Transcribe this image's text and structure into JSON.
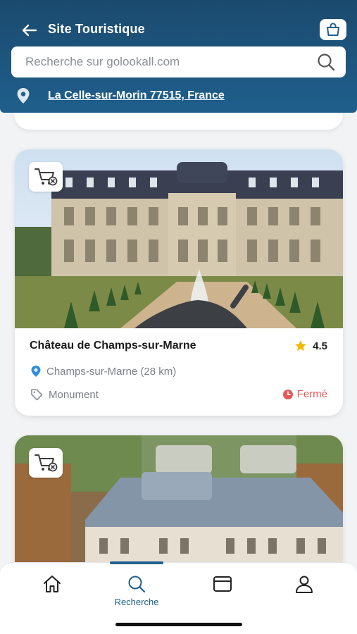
{
  "header": {
    "title": "Site Touristique",
    "back_icon": "arrow-left-icon",
    "cart_icon": "shopping-bag-icon"
  },
  "search": {
    "placeholder": "Recherche sur golookall.com",
    "icon": "search-icon"
  },
  "location": {
    "text": "La Celle-sur-Morin 77515, France",
    "icon": "location-pin-icon"
  },
  "cards": [
    {
      "name": "Château de Champs-sur-Marne",
      "rating": "4.5",
      "place": "Champs-sur-Marne (28 km)",
      "category": "Monument",
      "status": "Fermé",
      "badge_icon": "cart-remove-icon"
    },
    {
      "badge_icon": "cart-remove-icon"
    }
  ],
  "nav": {
    "items": [
      {
        "icon": "home-icon",
        "label": ""
      },
      {
        "icon": "search-icon",
        "label": "Recherche"
      },
      {
        "icon": "browser-window-icon",
        "label": ""
      },
      {
        "icon": "user-icon",
        "label": ""
      }
    ],
    "active_index": 1
  },
  "colors": {
    "header": "#1f5f8c",
    "accent": "#1f5f8c",
    "star": "#f5b800",
    "closed": "#e25a5a",
    "pin": "#2f8fe0"
  }
}
